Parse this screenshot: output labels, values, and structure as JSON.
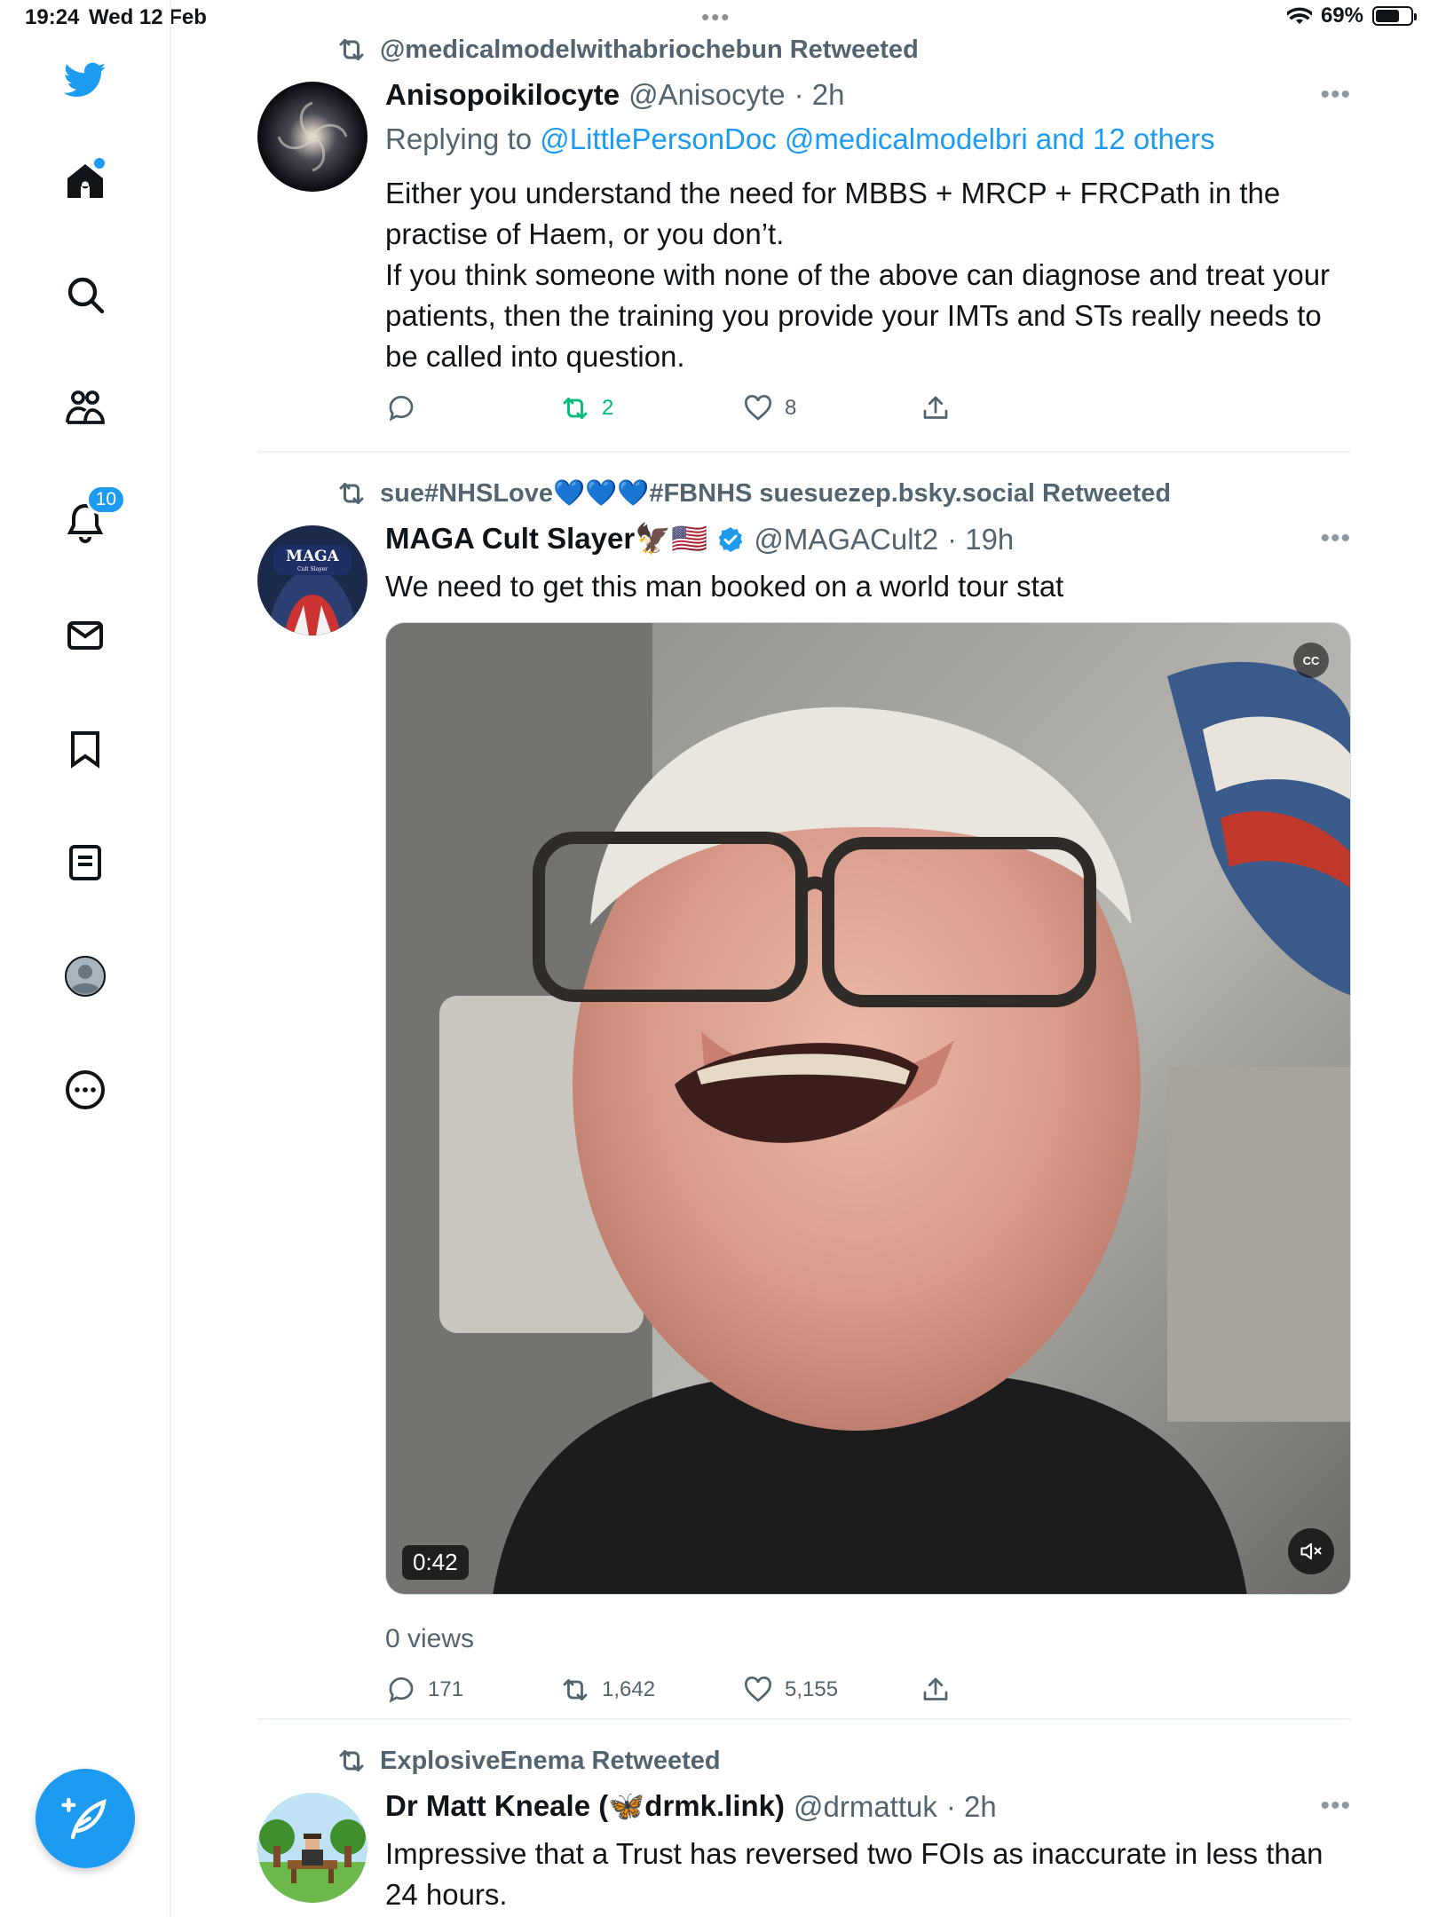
{
  "status_bar": {
    "time": "19:24",
    "date": "Wed 12 Feb",
    "battery": "69%",
    "battery_level": 0.69
  },
  "sidebar": {
    "notifications_badge": "10",
    "icons": [
      "twitter-logo-icon",
      "home-icon",
      "search-icon",
      "communities-icon",
      "notifications-icon",
      "messages-icon",
      "bookmarks-icon",
      "lists-icon",
      "profile-icon",
      "more-icon",
      "compose-icon"
    ]
  },
  "colors": {
    "accent": "#1d9bf0",
    "retweet_active": "#00ba7c",
    "secondary_text": "#536471"
  },
  "tweets": [
    {
      "retweeted_by": "@medicalmodelwithabriochebun Retweeted",
      "name": "Anisopoikilocyte",
      "handle": "@Anisocyte",
      "time": "· 2h",
      "reply_prefix": "Replying to",
      "reply_to": "@LittlePersonDoc @medicalmodelbri and 12 others",
      "text": "Either you understand the need for MBBS + MRCP + FRCPath in the practise of Haem, or you don’t.\nIf you think someone with none of the above can diagnose and treat your patients, then the training you provide your IMTs and STs really needs to be called into question.",
      "replies": "",
      "retweets": "2",
      "likes": "8"
    },
    {
      "retweeted_by": "sue#NHSLove💙💙💙#FBNHS suesuezep.bsky.social Retweeted",
      "name": "MAGA Cult Slayer🦅🇺🇸",
      "handle": "@MAGACult2",
      "time": "· 19h",
      "text": "We need to get this man booked on a world tour stat",
      "video_duration": "0:42",
      "cc_label": "CC",
      "views": "0 views",
      "replies": "171",
      "retweets": "1,642",
      "likes": "5,155",
      "avatar_text": "MAGA",
      "avatar_subtext": "Cult Slayer"
    },
    {
      "retweeted_by": "ExplosiveEnema Retweeted",
      "name": "Dr Matt Kneale (🦋drmk.link)",
      "handle": "@drmattuk",
      "time": "· 2h",
      "text": "Impressive that a Trust has reversed two FOIs as inaccurate in less than 24 hours."
    }
  ]
}
